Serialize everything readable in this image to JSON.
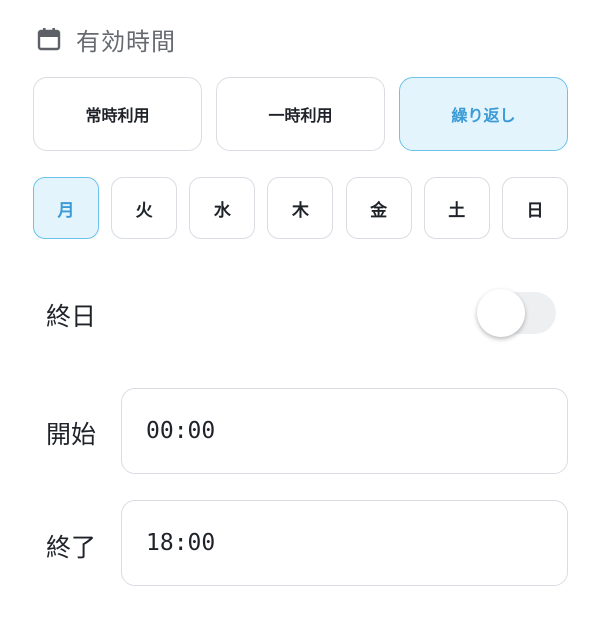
{
  "header": {
    "icon": "calendar-icon",
    "title": "有効時間"
  },
  "modes": [
    {
      "label": "常時利用",
      "active": false
    },
    {
      "label": "一時利用",
      "active": false
    },
    {
      "label": "繰り返し",
      "active": true
    }
  ],
  "days": [
    {
      "label": "月",
      "active": true
    },
    {
      "label": "火",
      "active": false
    },
    {
      "label": "水",
      "active": false
    },
    {
      "label": "木",
      "active": false
    },
    {
      "label": "金",
      "active": false
    },
    {
      "label": "土",
      "active": false
    },
    {
      "label": "日",
      "active": false
    }
  ],
  "all_day": {
    "label": "終日",
    "on": false
  },
  "start": {
    "label": "開始",
    "value": "00:00"
  },
  "end": {
    "label": "終了",
    "value": "18:00"
  },
  "colors": {
    "accent": "#3a9bd6",
    "accent_bg": "#e3f4fc",
    "accent_border": "#6cc3ea",
    "border": "#d9dde2"
  }
}
